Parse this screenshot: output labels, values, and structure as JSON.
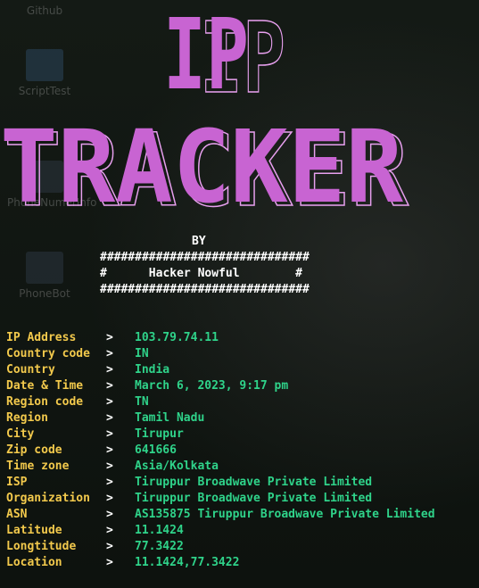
{
  "desktop": {
    "icons": [
      {
        "label": "Github"
      },
      {
        "label": "ScriptTest"
      },
      {
        "label": "PhoneNumerInfo"
      },
      {
        "label": "PhoneBot"
      }
    ]
  },
  "banner": {
    "line1": "IP",
    "line2": "TRACKER",
    "by": "BY",
    "border_top": "##############################",
    "author_line": "#      Hacker Nowful        #",
    "border_bottom": "##############################"
  },
  "separator": ">",
  "rows": [
    {
      "key": "IP Address",
      "value": "103.79.74.11"
    },
    {
      "key": "Country code",
      "value": "IN"
    },
    {
      "key": "Country",
      "value": "India"
    },
    {
      "key": "Date & Time",
      "value": "March 6, 2023, 9:17 pm"
    },
    {
      "key": "Region code",
      "value": "TN"
    },
    {
      "key": "Region",
      "value": "Tamil Nadu"
    },
    {
      "key": "City",
      "value": "Tirupur"
    },
    {
      "key": "Zip code",
      "value": "641666"
    },
    {
      "key": "Time zone",
      "value": "Asia/Kolkata"
    },
    {
      "key": "ISP",
      "value": "Tiruppur Broadwave Private Limited"
    },
    {
      "key": "Organization",
      "value": "Tiruppur Broadwave Private Limited"
    },
    {
      "key": "ASN",
      "value": "AS135875 Tiruppur Broadwave Private Limited"
    },
    {
      "key": "Latitude",
      "value": "11.1424"
    },
    {
      "key": "Longtitude",
      "value": "77.3422"
    },
    {
      "key": "Location",
      "value": "11.1424,77.3422"
    }
  ],
  "colors": {
    "banner": "#c864d2",
    "banner_shadow": "#e8a0ef",
    "key": "#f2c94c",
    "value": "#2fd38a",
    "text": "#ffffff"
  }
}
